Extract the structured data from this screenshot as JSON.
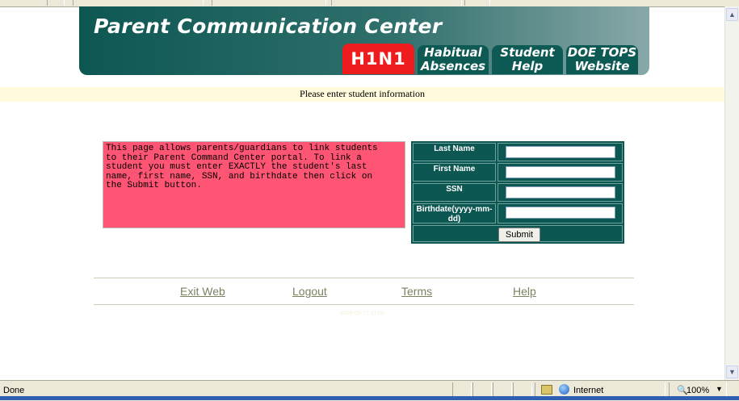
{
  "header": {
    "title": "Parent Communication Center",
    "tabs": [
      {
        "line1": "H1N1",
        "line2": ""
      },
      {
        "line1": "Habitual",
        "line2": "Absences"
      },
      {
        "line1": "Student",
        "line2": "Help"
      },
      {
        "line1": "DOE TOPS",
        "line2": "Website"
      }
    ],
    "h1n1_color": "#ee1c1c",
    "tab_color": "#0d5a55"
  },
  "instruction": "Please enter student information",
  "info_text": [
    "This page allows parents/guardians to link students",
    "to their Parent Command Center portal.  To link a",
    "student you must enter EXACTLY the student's last",
    "name, first name, SSN, and birthdate then click on",
    "the Submit button."
  ],
  "form": {
    "fields": [
      {
        "label": "Last Name",
        "value": ""
      },
      {
        "label": "First Name",
        "value": ""
      },
      {
        "label": "SSN",
        "value": ""
      },
      {
        "label": "Birthdate(yyyy-mm-dd)",
        "value": ""
      }
    ],
    "submit_label": "Submit"
  },
  "footer": {
    "links": [
      "Exit Web",
      "Logout",
      "Terms",
      "Help"
    ],
    "timestamp": "2009-09-17 11:00"
  },
  "statusbar": {
    "status": "Done",
    "zone": "Internet",
    "zoom": "100%"
  }
}
